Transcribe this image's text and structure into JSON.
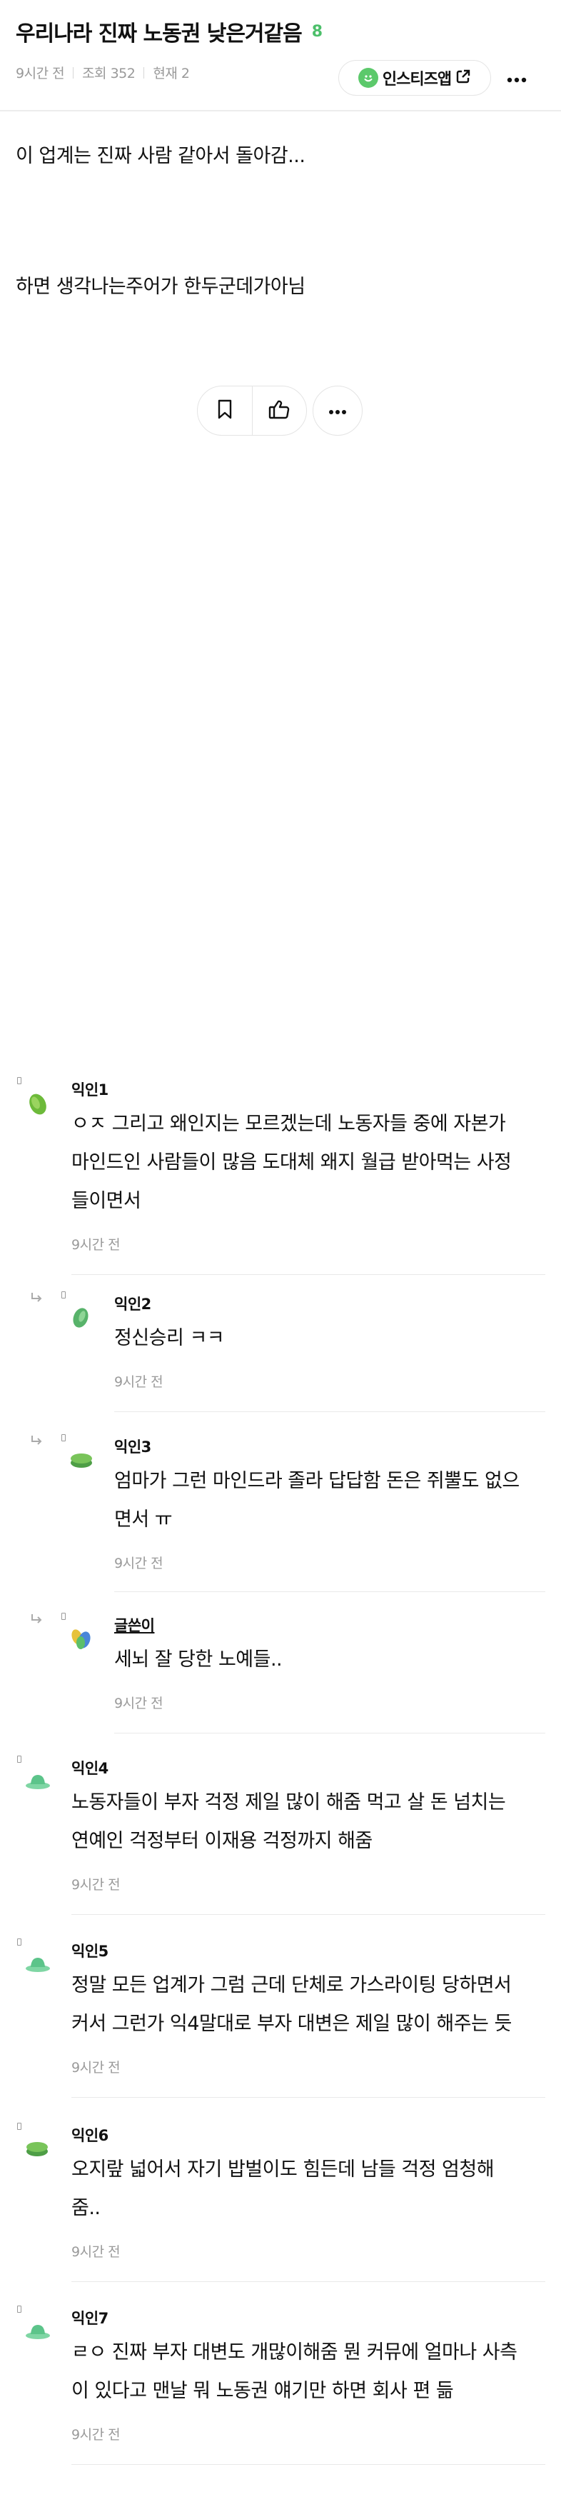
{
  "post": {
    "title": "우리나라 진짜 노동권 낮은거같음",
    "comment_count": "8",
    "time": "9시간 전",
    "views": "조회 352",
    "current": "현재 2",
    "insti_button": "인스티즈앱",
    "body_line1": "이 업계는 진짜 사람 같아서 돌아감...",
    "body_line2": "하면 생각나는주어가 한두군데가아님"
  },
  "icons": {
    "insti_logo": "insti-smile-icon",
    "external": "external-link-icon",
    "more": "more-horizontal-icon",
    "bookmark": "bookmark-icon",
    "like": "thumbs-up-icon",
    "reply": "reply-arrow-icon"
  },
  "colors": {
    "accent_green": "#4cbf6a"
  },
  "comments": [
    {
      "name": "익인1",
      "lines": [
        "ㅇㅈ 그리고 왜인지는 모르겠는데 노동자들 중에 자본가",
        "마인드인 사람들이 많음 도대체 왜지 월급 받아먹는 사정",
        "들이면서"
      ],
      "time": "9시간 전"
    },
    {
      "name": "익인2",
      "lines": [
        "정신승리 ㅋㅋ"
      ],
      "time": "9시간 전"
    },
    {
      "name": "익인3",
      "lines": [
        "엄마가 그런 마인드라 졸라 답답함 돈은 쥐뿔도 없으",
        "면서 ㅠ"
      ],
      "time": "9시간 전"
    },
    {
      "name": "글쓴이",
      "lines": [
        "세뇌 잘 당한 노예들.."
      ],
      "time": "9시간 전"
    },
    {
      "name": "익인4",
      "lines": [
        "노동자들이 부자 걱정 제일 많이 해줌 먹고 살 돈 넘치는",
        "연예인 걱정부터 이재용 걱정까지 해줌"
      ],
      "time": "9시간 전"
    },
    {
      "name": "익인5",
      "lines": [
        "정말 모든 업계가 그럼 근데 단체로 가스라이팅 당하면서",
        "커서 그런가 익4말대로 부자 대변은 제일 많이 해주는 듯"
      ],
      "time": "9시간 전"
    },
    {
      "name": "익인6",
      "lines": [
        "오지랖 넓어서 자기 밥벌이도 힘든데 남들 걱정 엄청해",
        "줌.."
      ],
      "time": "9시간 전"
    },
    {
      "name": "익인7",
      "lines": [
        "ㄹㅇ 진짜 부자 대변도 개많이해줌 뭔 커뮤에 얼마나 사측",
        "이 있다고 맨날 뭐 노동권 얘기만 하면 회사 편 듦"
      ],
      "time": "9시간 전"
    }
  ]
}
